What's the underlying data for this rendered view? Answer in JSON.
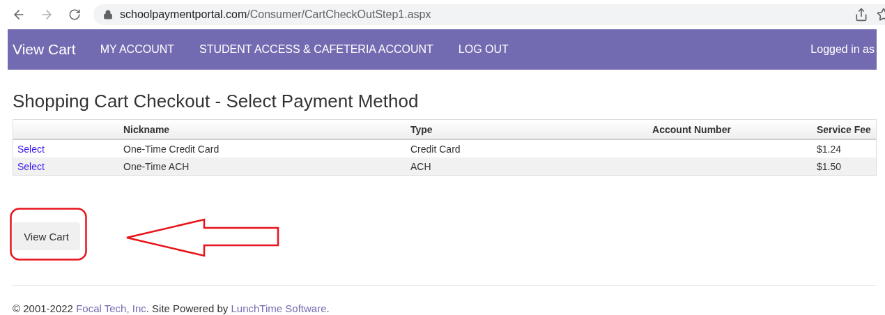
{
  "browser": {
    "url_host": "schoolpaymentportal.com",
    "url_path": "/Consumer/CartCheckOutStep1.aspx",
    "forward_disabled": true
  },
  "nav": {
    "brand": "View Cart",
    "items": [
      "MY ACCOUNT",
      "STUDENT ACCESS & CAFETERIA ACCOUNT",
      "LOG OUT"
    ],
    "user": "Logged in as"
  },
  "page": {
    "title": "Shopping Cart Checkout - Select Payment Method"
  },
  "table": {
    "columns": [
      "",
      "Nickname",
      "Type",
      "Account Number",
      "Service Fee"
    ],
    "rows": [
      {
        "action": "Select",
        "nickname": "One-Time Credit Card",
        "type": "Credit Card",
        "fee": "$1.24"
      },
      {
        "action": "Select",
        "nickname": "One-Time ACH",
        "type": "ACH",
        "fee": "$1.50"
      }
    ]
  },
  "view_cart_button": {
    "label": "View Cart",
    "highlighted": true
  },
  "footer": {
    "parts": [
      {
        "kind": "text",
        "text": "© 2001-2022 "
      },
      {
        "kind": "link",
        "text": "Focal Tech, Inc"
      },
      {
        "kind": "text",
        "text": ". Site Powered by "
      },
      {
        "kind": "link",
        "text": "LunchTime Software"
      },
      {
        "kind": "text",
        "text": "."
      }
    ]
  }
}
